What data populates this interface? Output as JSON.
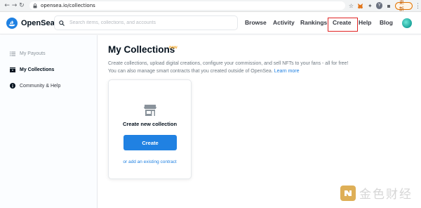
{
  "browser": {
    "url": "opensea.io/collections",
    "ext_avatar_letter": "Y",
    "update_label": "更新"
  },
  "header": {
    "brand": "OpenSea",
    "search_placeholder": "Search items, collections, and accounts",
    "nav": [
      {
        "label": "Browse"
      },
      {
        "label": "Activity"
      },
      {
        "label": "Rankings"
      },
      {
        "label": "Create"
      },
      {
        "label": "Help"
      },
      {
        "label": "Blog"
      }
    ],
    "highlight_color": "#e02424"
  },
  "sidebar": {
    "items": [
      {
        "label": "My Payouts",
        "icon": "list-icon",
        "active": false
      },
      {
        "label": "My Collections",
        "icon": "collection-icon",
        "active": true
      },
      {
        "label": "Community & Help",
        "icon": "info-icon",
        "active": false
      }
    ]
  },
  "main": {
    "title": "My Collections",
    "badge": "new",
    "desc_line1": "Create collections, upload digital creations, configure your commission, and sell NFTs to your fans - all for free!",
    "desc_line2": "You can also manage smart contracts that you created outside of OpenSea.",
    "learn_more": "Learn more",
    "card": {
      "icon": "storefront-icon",
      "title": "Create new collection",
      "button": "Create",
      "link": "or add an existing contract"
    }
  },
  "watermark": {
    "text": "金色财经"
  },
  "colors": {
    "accent": "#2081e2",
    "badge": "#f5a623"
  }
}
